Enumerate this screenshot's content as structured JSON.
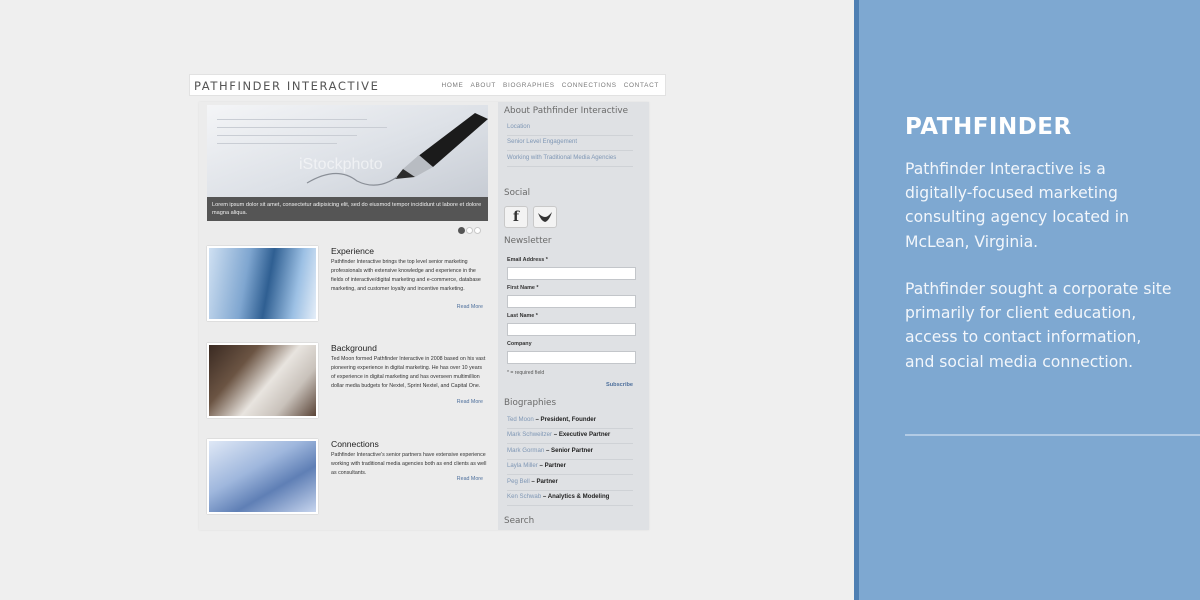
{
  "site": {
    "logo": "PATHFINDER INTERACTIVE",
    "nav": [
      "HOME",
      "ABOUT",
      "BIOGRAPHIES",
      "CONNECTIONS",
      "CONTACT"
    ],
    "hero": {
      "watermark": "iStockphoto",
      "caption": "Lorem ipsum dolor sit amet, consectetur adipisicing elit, sed do eiusmod tempor incididunt ut labore et dolore magna aliqua.",
      "slide_count": 3,
      "active_slide": 1
    },
    "features": [
      {
        "title": "Experience",
        "text": "Pathfinder Interactive brings the top level senior marketing professionals with extensive knowledge and experience in the fields of interactive/digital marketing and e-commerce, database marketing, and customer loyalty and incentive marketing.",
        "more": "Read More"
      },
      {
        "title": "Background",
        "text": "Ted Moon formed Pathfinder Interactive in 2008 based on his vast pioneering experience in digital marketing. He has over 10 years of experience in digital marketing and has overseen multimillion dollar media budgets for Nextel, Sprint Nextel, and Capital One.",
        "more": "Read More"
      },
      {
        "title": "Connections",
        "text": "Pathfinder Interactive's senior partners have extensive experience working with traditional media agencies both as end clients as well as consultants.",
        "more": "Read More"
      }
    ],
    "sidebar": {
      "about_heading": "About Pathfinder Interactive",
      "about_links": [
        "Location",
        "Senior Level Engagement",
        "Working with Traditional Media Agencies"
      ],
      "social_heading": "Social",
      "social": [
        {
          "icon": "facebook-icon",
          "glyph": "f"
        },
        {
          "icon": "twitter-bird-icon",
          "glyph": ""
        }
      ],
      "newsletter_heading": "Newsletter",
      "newsletter_fields": [
        "Email Address *",
        "First Name *",
        "Last Name *",
        "Company"
      ],
      "required_note": "* = required field",
      "subscribe": "Subscribe",
      "bios_heading": "Biographies",
      "bios": [
        {
          "name": "Ted Moon",
          "role": " – President, Founder"
        },
        {
          "name": "Mark Schweitzer",
          "role": " – Executive Partner"
        },
        {
          "name": "Mark Gorman",
          "role": " – Senior Partner"
        },
        {
          "name": "Layla Miller",
          "role": " – Partner"
        },
        {
          "name": "Peg Bell",
          "role": " – Partner"
        },
        {
          "name": "Ken Schwab",
          "role": " – Analytics & Modeling"
        }
      ],
      "search_heading": "Search"
    }
  },
  "panel": {
    "title": "PATHFINDER",
    "paragraph_1": "Pathfinder Interactive is a digitally-focused marketing consulting agency located in McLean, Virginia.",
    "paragraph_2": "Pathfinder sought a corporate site primarily for client education, access to contact information, and social media connection.",
    "colors": {
      "panel": "#7ea8d1",
      "stripe": "#4e7fb3",
      "link": "#7f97b5"
    }
  }
}
